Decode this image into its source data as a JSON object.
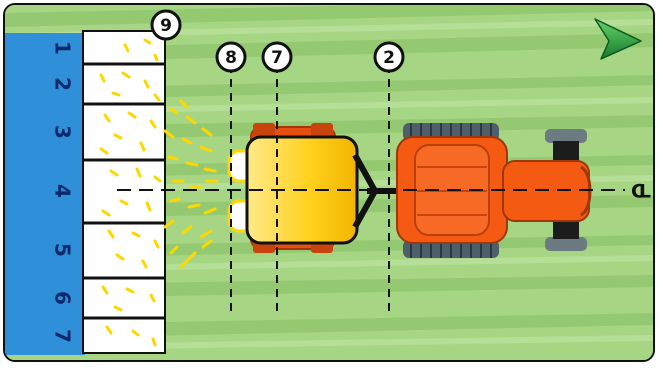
{
  "rows": {
    "labels": [
      "1",
      "2",
      "3",
      "4",
      "5",
      "6",
      "7"
    ]
  },
  "callouts": {
    "section9": "9",
    "section8": "8",
    "section7": "7",
    "section2": "2"
  },
  "centerline": {
    "label": "CL"
  },
  "colors": {
    "field_light": "#a9d98a",
    "field_dark": "#8fc66b",
    "side_bar": "#2f8fd8",
    "tractor": "#f45a12",
    "tank": "#ffd21f",
    "spray": "#ffd700",
    "arrow": "#2aa14a"
  },
  "icons": {
    "direction": "green-arrow-icon"
  }
}
